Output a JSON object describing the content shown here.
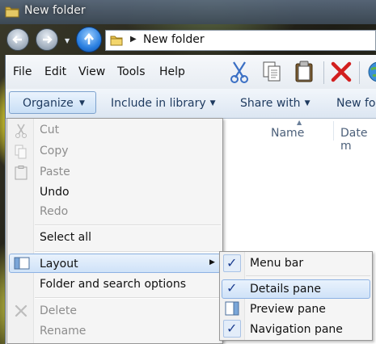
{
  "window": {
    "title": "New folder"
  },
  "address": {
    "path": "New folder"
  },
  "menubar": {
    "items": [
      "File",
      "Edit",
      "View",
      "Tools",
      "Help"
    ]
  },
  "commandbar": {
    "organize": "Organize",
    "include_in_library": "Include in library",
    "share_with": "Share with",
    "new_folder": "New fo"
  },
  "columns": {
    "name": "Name",
    "date": "Date m"
  },
  "organize_menu": {
    "cut": "Cut",
    "copy": "Copy",
    "paste": "Paste",
    "undo": "Undo",
    "redo": "Redo",
    "select_all": "Select all",
    "layout": "Layout",
    "folder_options": "Folder and search options",
    "delete": "Delete",
    "rename": "Rename"
  },
  "layout_submenu": {
    "menu_bar": {
      "label": "Menu bar",
      "checked": true
    },
    "details_pane": {
      "label": "Details pane",
      "checked": true
    },
    "preview_pane": {
      "label": "Preview pane",
      "checked": false
    },
    "navigation_pane": {
      "label": "Navigation pane",
      "checked": true
    }
  },
  "icons": {
    "title": "folder-icon",
    "toolbar": [
      "cut-icon",
      "copy-icon",
      "paste-icon",
      "delete-icon",
      "globe-icon"
    ]
  },
  "colors": {
    "accent": "#1e3a5f",
    "highlight": "#cfe2f8",
    "check": "#1c3d8f",
    "delete": "#d21f1f"
  }
}
